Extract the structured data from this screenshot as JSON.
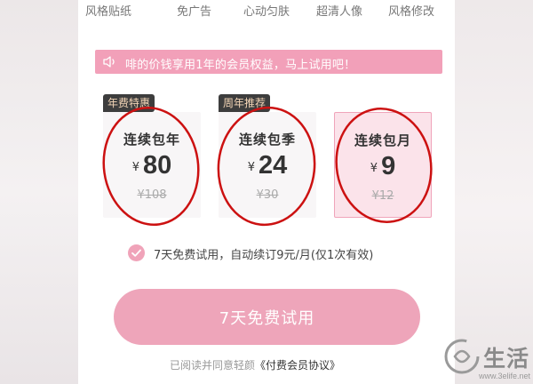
{
  "features": [
    "风格贴纸",
    "免广告",
    "心动匀肤",
    "超清人像",
    "风格修改"
  ],
  "notice": {
    "text": "啡的价钱享用1年的会员权益，马上试用吧！",
    "icon": "speaker-icon"
  },
  "plans": [
    {
      "badge": "年费特惠",
      "name": "连续包年",
      "currency": "¥",
      "price": "80",
      "original": "¥108",
      "selected": false
    },
    {
      "badge": "周年推荐",
      "name": "连续包季",
      "currency": "¥",
      "price": "24",
      "original": "¥30",
      "selected": false
    },
    {
      "badge": "",
      "name": "连续包月",
      "currency": "¥",
      "price": "9",
      "original": "¥12",
      "selected": true
    }
  ],
  "trial": {
    "text": "7天免费试用，自动续订9元/月(仅1次有效)",
    "checked": true
  },
  "cta": {
    "label": "7天免费试用"
  },
  "agreement": {
    "prefix": "已阅读并同意轻颜",
    "link": "《付费会员协议》"
  },
  "watermark": {
    "text": "生活",
    "url": "www.3elife.net"
  },
  "colors": {
    "accent": "#eea5ba",
    "notice_bg": "#f2a0b9",
    "circle": "#cc1111",
    "badge_bg": "#3d3d3d"
  }
}
